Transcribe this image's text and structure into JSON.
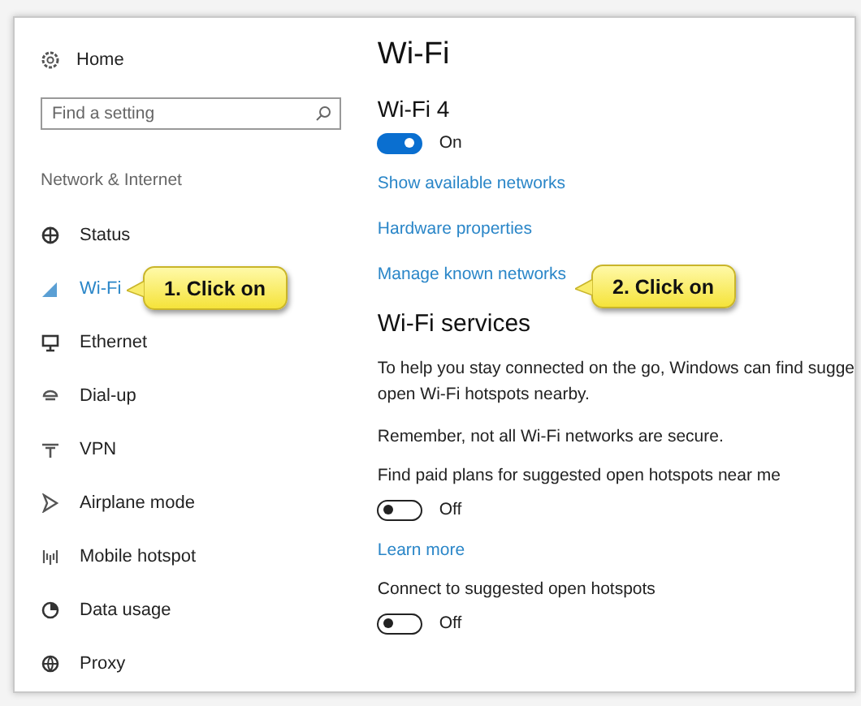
{
  "sidebar": {
    "home": "Home",
    "search": {
      "placeholder": "Find a setting"
    },
    "section": "Network & Internet",
    "items": [
      {
        "label": "Status",
        "selected": false
      },
      {
        "label": "Wi-Fi",
        "selected": true
      },
      {
        "label": "Ethernet",
        "selected": false
      },
      {
        "label": "Dial-up",
        "selected": false
      },
      {
        "label": "VPN",
        "selected": false
      },
      {
        "label": "Airplane mode",
        "selected": false
      },
      {
        "label": "Mobile hotspot",
        "selected": false
      },
      {
        "label": "Data usage",
        "selected": false
      },
      {
        "label": "Proxy",
        "selected": false
      }
    ]
  },
  "main": {
    "title": "Wi-Fi",
    "adapter": "Wi-Fi 4",
    "rows": [
      {
        "kind": "toggle",
        "on": true,
        "label": "On"
      },
      {
        "kind": "link",
        "text": "Show available networks"
      },
      {
        "kind": "link",
        "text": "Hardware properties"
      },
      {
        "kind": "link",
        "text": "Manage known networks"
      },
      {
        "kind": "heading",
        "text": "Wi-Fi services"
      },
      {
        "kind": "text",
        "lines": [
          "To help you stay connected on the go, Windows can find sugge",
          "open Wi-Fi hotspots nearby."
        ]
      },
      {
        "kind": "text",
        "lines": [
          "Remember, not all Wi-Fi networks are secure."
        ]
      },
      {
        "kind": "label",
        "text": "Find paid plans for suggested open hotspots near me"
      },
      {
        "kind": "toggle",
        "on": false,
        "label": "Off"
      },
      {
        "kind": "link",
        "text": "Learn more"
      },
      {
        "kind": "label",
        "text": "Connect to suggested open hotspots"
      },
      {
        "kind": "toggle",
        "on": false,
        "label": "Off"
      }
    ]
  },
  "callouts": [
    {
      "text": "1. Click on"
    },
    {
      "text": "2. Click on"
    }
  ]
}
